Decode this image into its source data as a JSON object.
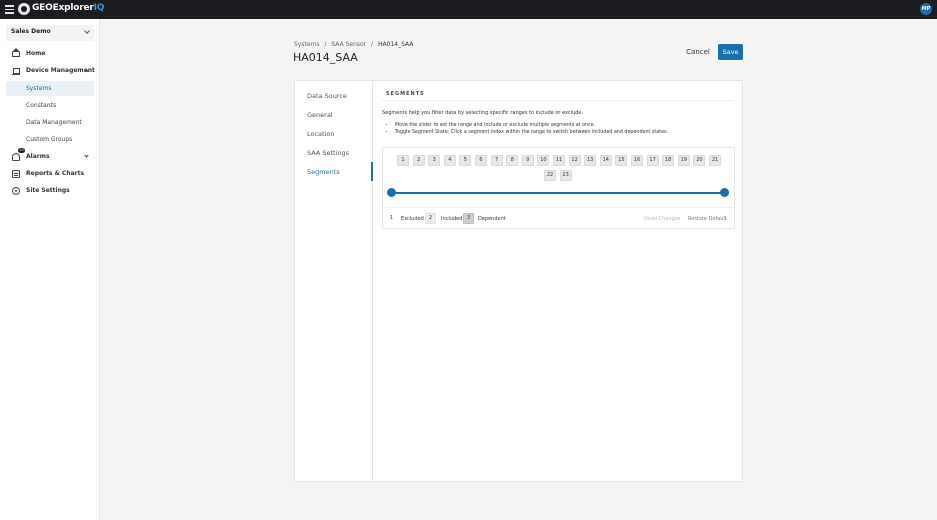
{
  "app": {
    "brand_main": "GEOExplorer",
    "brand_suffix": "IQ",
    "user_initials": "MP",
    "accent_color": "#1670b0"
  },
  "sidebar": {
    "org_select": "Sales Demo",
    "items": {
      "home": "Home",
      "device_management": "Device Management",
      "systems": "Systems",
      "constants": "Constants",
      "data_management": "Data Management",
      "custom_groups": "Custom Groups",
      "alarms": "Alarms",
      "alarms_badge": "10",
      "reports": "Reports & Charts",
      "site_settings": "Site Settings"
    }
  },
  "header": {
    "breadcrumb": [
      "Systems",
      "/",
      "SAA Sensor",
      "/",
      "HA014_SAA"
    ],
    "title": "HA014_SAA",
    "cancel_label": "Cancel",
    "save_label": "Save"
  },
  "tabs": {
    "data_source": "Data Source",
    "general": "General",
    "location": "Location",
    "saa_settings": "SAA Settings",
    "segments": "Segments",
    "active": "Segments"
  },
  "segments": {
    "section_title": "SEGMENTS",
    "description": "Segments help you filter data by selecting specific ranges to include or exclude.",
    "bullets": [
      "Move the slider to set the range and include or exclude multiple segments at once.",
      "Toggle Segment State: Click a segment index within the range to switch between included and dependent states."
    ],
    "indices": [
      "1",
      "2",
      "3",
      "4",
      "5",
      "6",
      "7",
      "8",
      "9",
      "10",
      "11",
      "12",
      "13",
      "14",
      "15",
      "16",
      "17",
      "18",
      "19",
      "20",
      "21",
      "22",
      "23"
    ],
    "slider_range": [
      1,
      23
    ],
    "legend": {
      "excluded_num": "1",
      "excluded_label": "Excluded",
      "included_num": "2",
      "included_label": "Included",
      "dependent_num": "3",
      "dependent_label": "Dependent"
    },
    "undo_label": "Undo Changes",
    "restore_label": "Restore Default"
  }
}
